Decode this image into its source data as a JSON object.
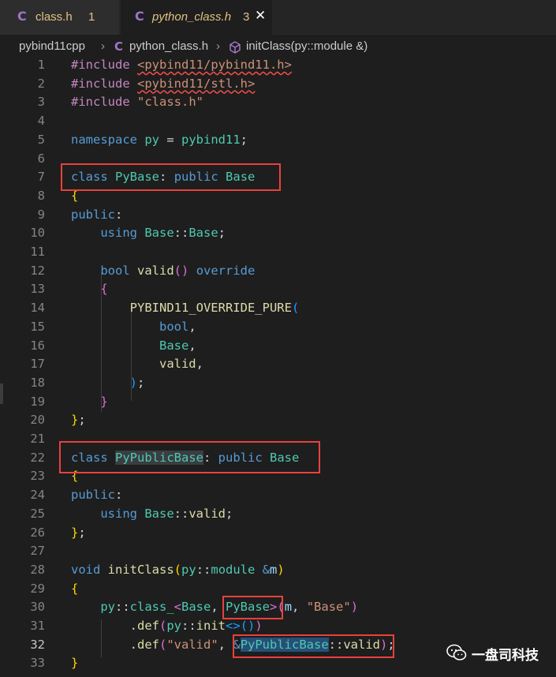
{
  "tabs": [
    {
      "icon": "C",
      "name": "class.h",
      "badge": "1"
    },
    {
      "icon": "C",
      "name": "python_class.h",
      "badge": "3",
      "close": "✕"
    }
  ],
  "breadcrumb": {
    "project": "pybind11cpp",
    "file_icon": "C",
    "file": "python_class.h",
    "sep": "›",
    "symbol": "initClass(py::module &)"
  },
  "editor": {
    "active_line": 32,
    "lines": [
      {
        "n": "1"
      },
      {
        "n": "2"
      },
      {
        "n": "3"
      },
      {
        "n": "4"
      },
      {
        "n": "5"
      },
      {
        "n": "6"
      },
      {
        "n": "7"
      },
      {
        "n": "8"
      },
      {
        "n": "9"
      },
      {
        "n": "10"
      },
      {
        "n": "11"
      },
      {
        "n": "12"
      },
      {
        "n": "13"
      },
      {
        "n": "14"
      },
      {
        "n": "15"
      },
      {
        "n": "16"
      },
      {
        "n": "17"
      },
      {
        "n": "18"
      },
      {
        "n": "19"
      },
      {
        "n": "20"
      },
      {
        "n": "21"
      },
      {
        "n": "22"
      },
      {
        "n": "23"
      },
      {
        "n": "24"
      },
      {
        "n": "25"
      },
      {
        "n": "26"
      },
      {
        "n": "27"
      },
      {
        "n": "28"
      },
      {
        "n": "29"
      },
      {
        "n": "30"
      },
      {
        "n": "31"
      },
      {
        "n": "32"
      },
      {
        "n": "33"
      }
    ]
  },
  "watermark": {
    "text": "一盘司科技"
  }
}
